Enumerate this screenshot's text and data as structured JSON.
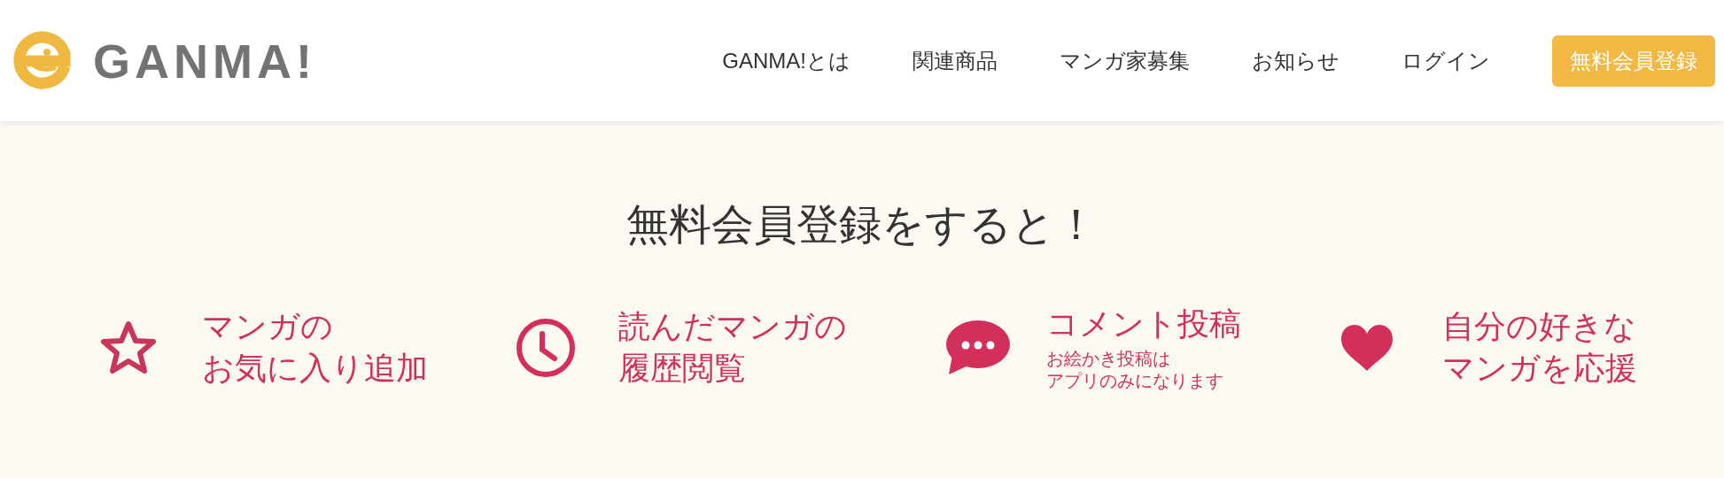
{
  "header": {
    "logo": "GANMA!",
    "nav": [
      "GANMA!とは",
      "関連商品",
      "マンガ家募集",
      "お知らせ",
      "ログイン"
    ],
    "cta": "無料会員登録"
  },
  "heading": "無料会員登録をすると！",
  "features": [
    {
      "kind": "star",
      "lines": [
        "マンガの",
        "お気に入り追加"
      ]
    },
    {
      "kind": "clock",
      "lines": [
        "読んだマンガの",
        "履歴閲覧"
      ]
    },
    {
      "kind": "speech",
      "lines": [
        "コメント投稿"
      ],
      "note": [
        "お絵かき投稿は",
        "アプリのみになります"
      ]
    },
    {
      "kind": "heart",
      "lines": [
        "自分の好きな",
        "マンガを応援"
      ]
    }
  ]
}
